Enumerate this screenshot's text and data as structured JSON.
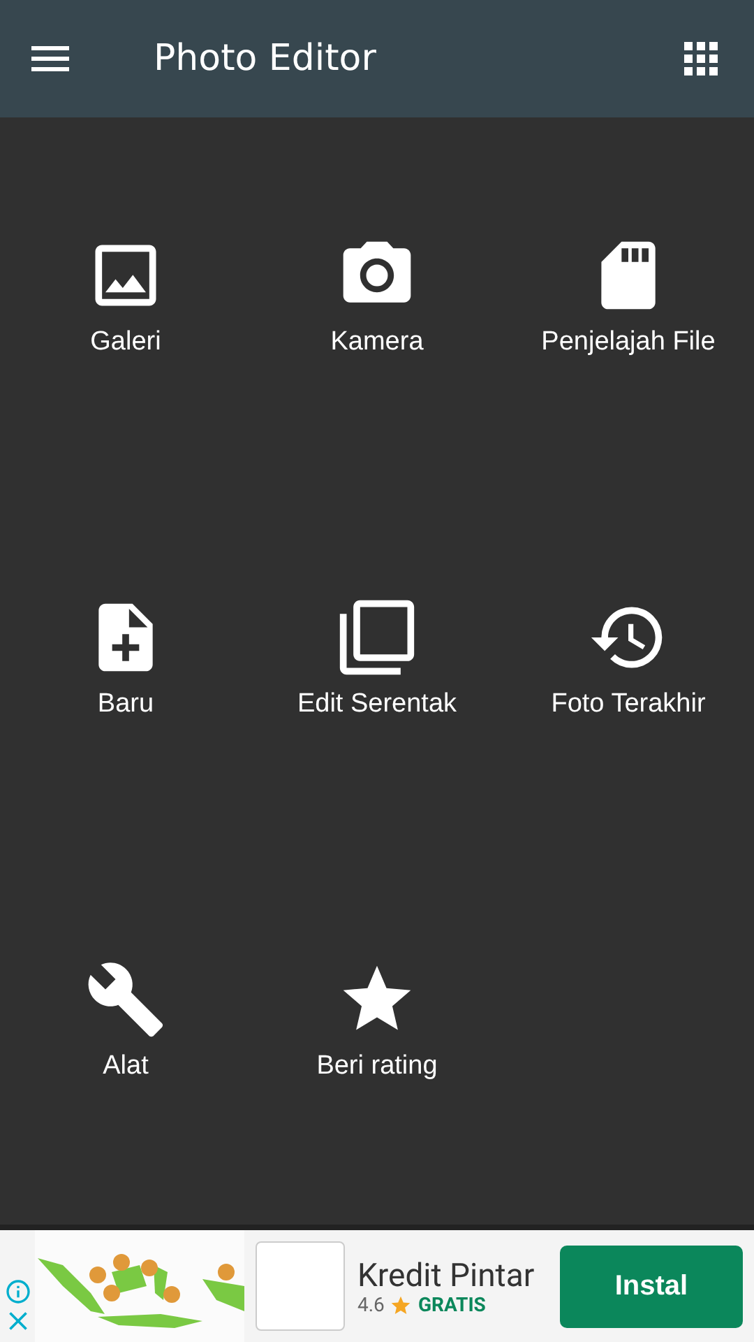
{
  "app_bar": {
    "title": "Photo Editor"
  },
  "tiles": [
    {
      "kind": "gallery",
      "label": "Galeri"
    },
    {
      "kind": "camera",
      "label": "Kamera"
    },
    {
      "kind": "sdcard",
      "label": "Penjelajah File"
    },
    {
      "kind": "newfile",
      "label": "Baru"
    },
    {
      "kind": "batch",
      "label": "Edit Serentak"
    },
    {
      "kind": "history",
      "label": "Foto Terakhir"
    },
    {
      "kind": "tools",
      "label": "Alat"
    },
    {
      "kind": "rate",
      "label": "Beri rating"
    }
  ],
  "ad": {
    "app_name": "Kredit Pintar",
    "rating": "4.6",
    "price": "GRATIS",
    "button": "Instal"
  }
}
